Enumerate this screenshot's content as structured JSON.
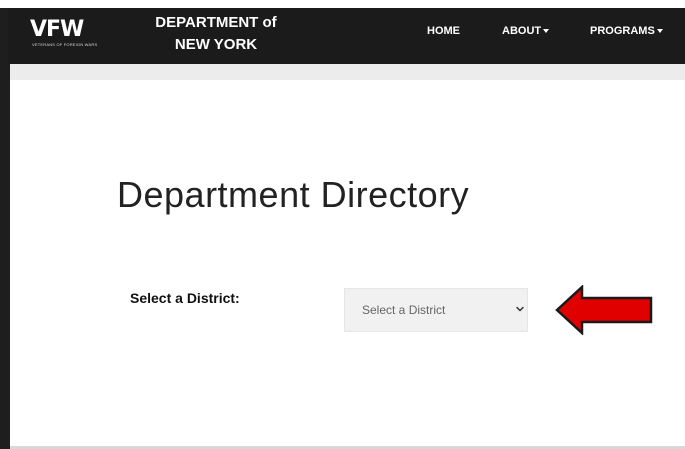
{
  "brand": {
    "logo_text": "VFW",
    "logo_subtext": "VETERANS OF FOREIGN WARS",
    "title_line1": "DEPARTMENT of",
    "title_line2": "NEW YORK"
  },
  "nav": {
    "home": "HOME",
    "about": "ABOUT",
    "programs": "PROGRAMS"
  },
  "main": {
    "page_title": "Department Directory",
    "district_label": "Select a District:",
    "district_select": {
      "selected": "Select a District"
    }
  },
  "icons": {
    "chevron": "chevron-down-icon",
    "caret": "caret-down-icon",
    "annotation_arrow": "left-arrow-icon"
  },
  "colors": {
    "navbar": "#1b1b1b",
    "arrow_fill": "#e00000",
    "select_bg": "#f1f1f1"
  }
}
